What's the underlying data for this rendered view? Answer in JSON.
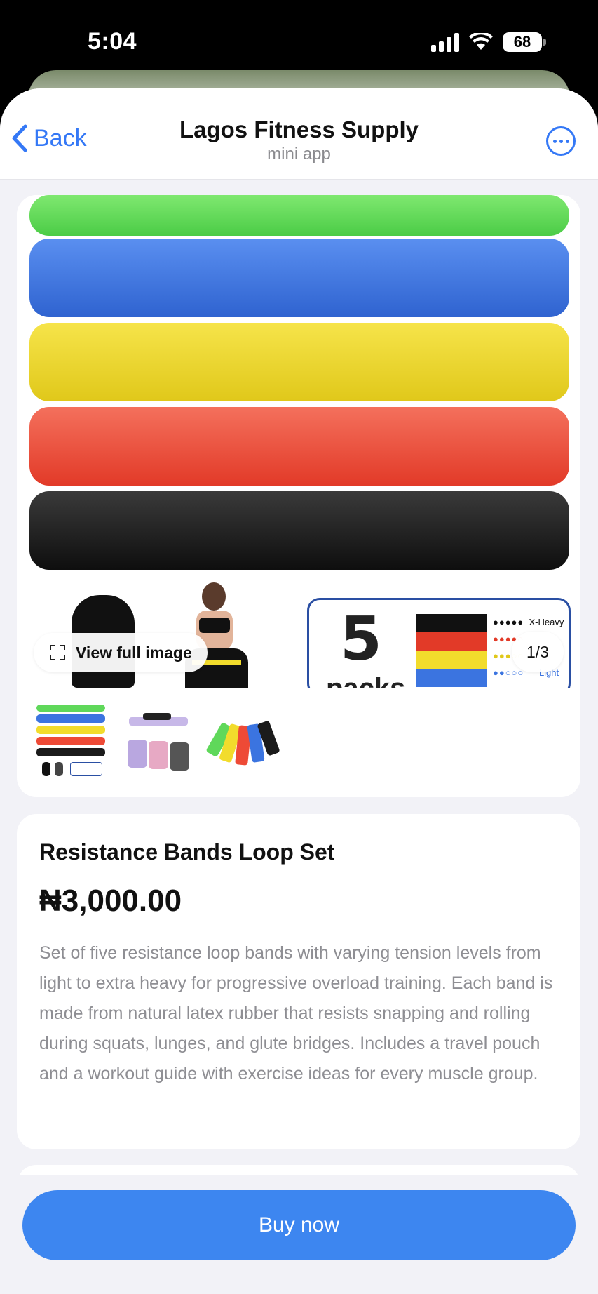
{
  "status_bar": {
    "time": "5:04",
    "battery": "68"
  },
  "nav": {
    "back_label": "Back",
    "title": "Lagos Fitness Supply",
    "subtitle": "mini app"
  },
  "gallery": {
    "view_full_label": "View full image",
    "counter": "1/3",
    "main_image": {
      "bands": [
        "#5fd85a",
        "#3b74e0",
        "#f2dc2c",
        "#ee4a36",
        "#1b1b1b"
      ],
      "pack_number": "5",
      "pack_text": "packs",
      "levels": [
        "X-Heavy",
        "Light"
      ]
    },
    "thumbnail_count": 3
  },
  "product": {
    "name": "Resistance Bands Loop Set",
    "price": "₦3,000.00",
    "description": "Set of five resistance loop bands with varying tension levels from light to extra heavy for progressive overload training. Each band is made from natural latex rubber that resists snapping and rolling during squats, lunges, and glute bridges. Includes a travel pouch and a workout guide with exercise ideas for every muscle group."
  },
  "actions": {
    "buy_label": "Buy now"
  },
  "colors": {
    "accent": "#3478f6",
    "buy_button": "#3d86f0",
    "background": "#f2f2f7"
  }
}
